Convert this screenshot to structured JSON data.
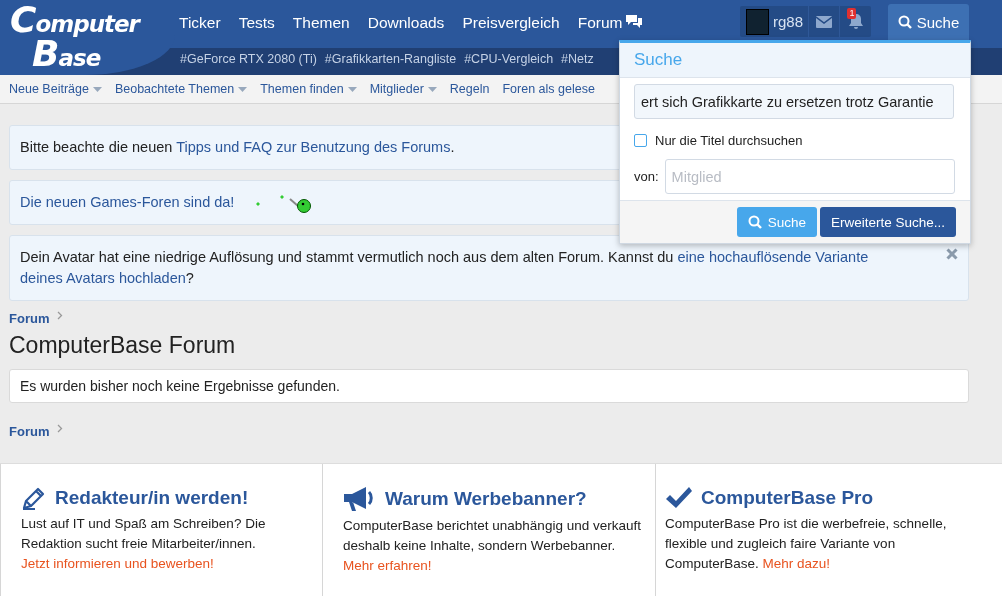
{
  "header": {
    "logo": {
      "line1": "Computer",
      "line2": "Base"
    },
    "nav": [
      {
        "label": "Ticker",
        "kind": "plain"
      },
      {
        "label": "Tests",
        "kind": "plain"
      },
      {
        "label": "Themen",
        "kind": "plain"
      },
      {
        "label": "Downloads",
        "kind": "plain"
      },
      {
        "label": "Preisvergleich",
        "kind": "plain"
      },
      {
        "label": "Forum",
        "kind": "chat"
      }
    ],
    "hashtags": [
      "#GeForce RTX 2080 (Ti)",
      "#Grafikkarten-Rangliste",
      "#CPU-Vergleich",
      "#Netz"
    ],
    "user": {
      "name": "rg88",
      "notification_count": "1"
    },
    "search_button": {
      "label": "Suche",
      "selected": true
    }
  },
  "subnav": [
    {
      "label": "Neue Beiträge",
      "dropdown": true
    },
    {
      "label": "Beobachtete Themen",
      "dropdown": true
    },
    {
      "label": "Themen finden",
      "dropdown": true
    },
    {
      "label": "Mitglieder",
      "dropdown": true
    },
    {
      "label": "Regeln",
      "dropdown": false
    },
    {
      "label": "Foren als gelese",
      "dropdown": false
    }
  ],
  "notices": [
    {
      "parts": [
        {
          "text": "Bitte beachte die neuen ",
          "kind": "text"
        },
        {
          "text": "Tipps und FAQ zur Benutzung des Forums",
          "kind": "link"
        },
        {
          "text": ".",
          "kind": "text"
        }
      ],
      "decoration": false,
      "dismissible": false
    },
    {
      "parts": [
        {
          "text": "Die neuen Games-Foren sind da!",
          "kind": "link"
        }
      ],
      "decoration": true,
      "dismissible": false
    },
    {
      "parts": [
        {
          "text": "Dein Avatar hat eine niedrige Auflösung und stammt vermutlich noch aus dem alten Forum. Kannst du ",
          "kind": "text"
        },
        {
          "text": "eine hochauflösende Variante",
          "kind": "link"
        },
        {
          "text": "deines Avatars hochladen",
          "kind": "link"
        },
        {
          "text": "?",
          "kind": "text"
        }
      ],
      "decoration": false,
      "dismissible": true
    }
  ],
  "breadcrumb_top": [
    "Forum"
  ],
  "page_title": "ComputerBase Forum",
  "message": "Es wurden bisher noch keine Ergebnisse gefunden.",
  "breadcrumb_bottom": [
    "Forum"
  ],
  "footer": [
    {
      "kind": "pencil",
      "title": "Redakteur/in werden!",
      "text": "Lust auf IT und Spaß am Schreiben? Die Redaktion sucht freie Mitarbeiter/innen. ",
      "link": "Jetzt informieren und bewerben!"
    },
    {
      "kind": "megaphone",
      "title": "Warum Werbebanner?",
      "text": "ComputerBase berichtet unabhängig und verkauft deshalb keine Inhalte, sondern Werbebanner. ",
      "link": "Mehr erfahren!"
    },
    {
      "kind": "check",
      "title": "ComputerBase Pro",
      "text": "ComputerBase Pro ist die werbefreie, schnelle, flexible und zugleich faire Variante von ComputerBase. ",
      "link": "Mehr dazu!"
    }
  ],
  "search_popup": {
    "title": "Suche",
    "query": "ert sich Grafikkarte zu ersetzen trotz Garantie",
    "titles_only": {
      "label": "Nur die Titel durchsuchen",
      "checked": false
    },
    "member_label": "von:",
    "member_placeholder": "Mitglied",
    "buttons": [
      {
        "label": "Suche",
        "kind": "primary"
      },
      {
        "label": "Erweiterte Suche...",
        "kind": "secondary"
      }
    ]
  }
}
